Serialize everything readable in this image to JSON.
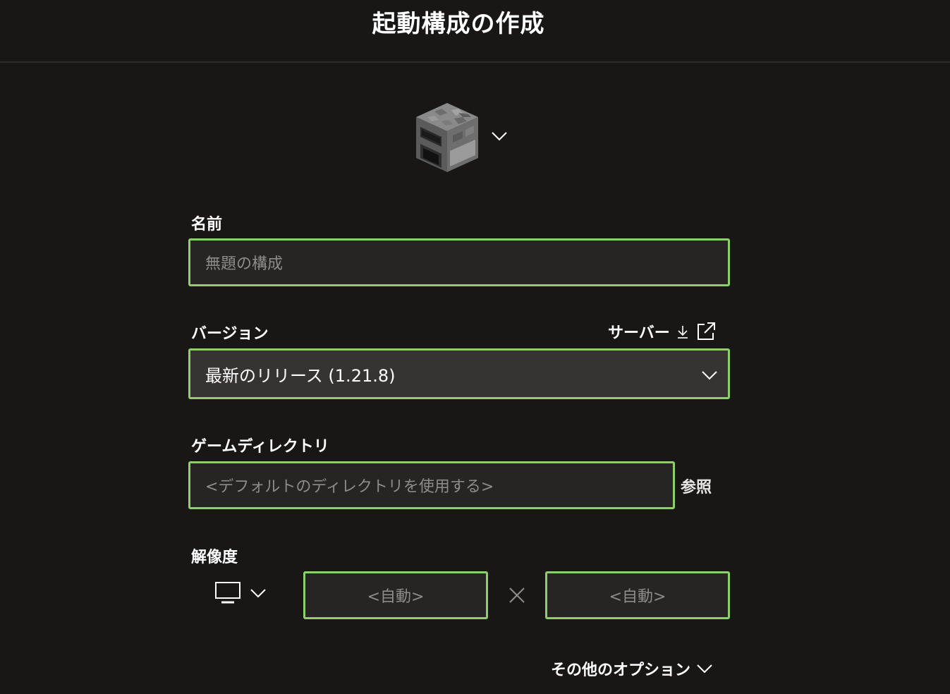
{
  "header": {
    "title": "起動構成の作成"
  },
  "profile_icon": {
    "icon": "furnace-block-icon"
  },
  "name": {
    "label": "名前",
    "placeholder": "無題の構成",
    "value": ""
  },
  "version": {
    "label": "バージョン",
    "selected": "最新のリリース (1.21.8)",
    "server_link": "サーバー"
  },
  "game_directory": {
    "label": "ゲームディレクトリ",
    "placeholder": "<デフォルトのディレクトリを使用する>",
    "browse": "参照"
  },
  "resolution": {
    "label": "解像度",
    "width_placeholder": "<自動>",
    "height_placeholder": "<自動>"
  },
  "more_options": {
    "label": "その他のオプション"
  },
  "colors": {
    "background": "#181716",
    "field_border": "#8fcf6a",
    "field_bg": "#262524",
    "select_bg": "#363433",
    "placeholder": "#8e8c8a"
  }
}
